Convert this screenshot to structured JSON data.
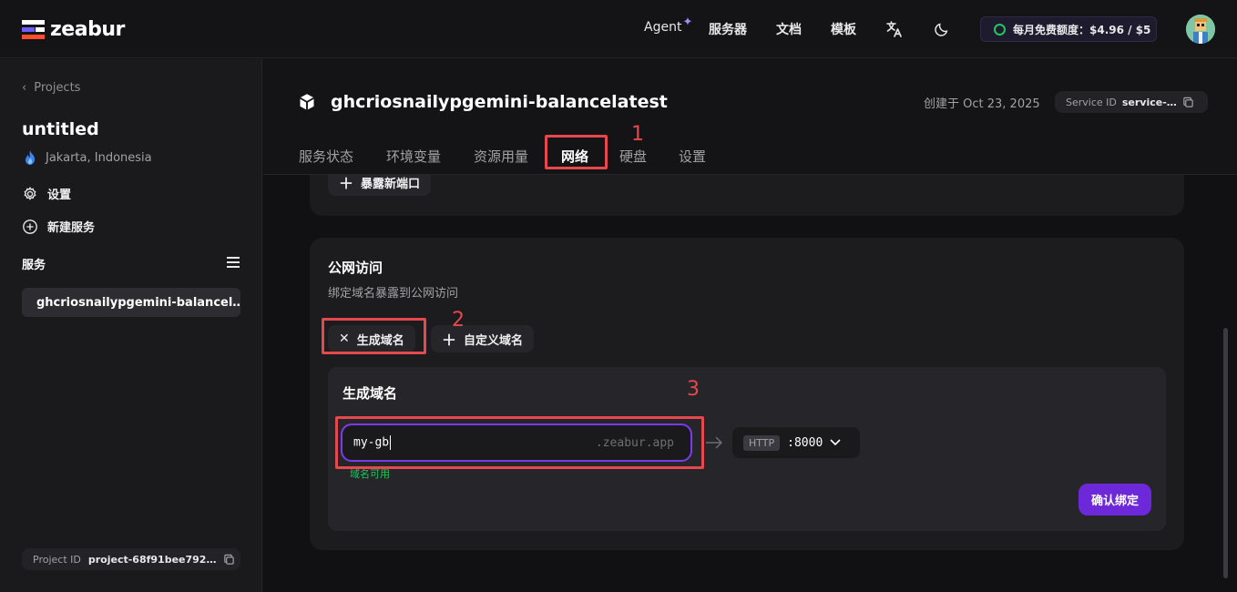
{
  "app": {
    "name": "zeabur"
  },
  "topnav": {
    "agent": "Agent",
    "servers": "服务器",
    "docs": "文档",
    "templates": "模板",
    "quota": "每月免费额度：$4.96 / $5"
  },
  "sidebar": {
    "back": "Projects",
    "project_title": "untitled",
    "region": "Jakarta, Indonesia",
    "settings": "设置",
    "new_service": "新建服务",
    "services_heading": "服务",
    "service_item": "ghcriosnailypgemini-balancel…",
    "project_id_label": "Project ID",
    "project_id": "project-68f91bee792…"
  },
  "service": {
    "name": "ghcriosnailypgemini-balancelatest",
    "created": "创建于 Oct 23, 2025",
    "service_id_label": "Service ID",
    "service_id": "service-…"
  },
  "tabs": [
    "服务状态",
    "环境变量",
    "资源用量",
    "网络",
    "硬盘",
    "设置"
  ],
  "active_tab": "网络",
  "expose_port": "暴露新端口",
  "public_access": {
    "title": "公网访问",
    "desc": "绑定域名暴露到公网访问",
    "generate_chip": "生成域名",
    "custom_chip": "自定义域名",
    "panel_title": "生成域名",
    "input_value": "my-gb",
    "suffix": ".zeabur.app",
    "status": "域名可用",
    "protocol": "HTTP",
    "port": ":8000",
    "confirm": "确认绑定"
  },
  "annotations": [
    "1",
    "2",
    "3"
  ]
}
